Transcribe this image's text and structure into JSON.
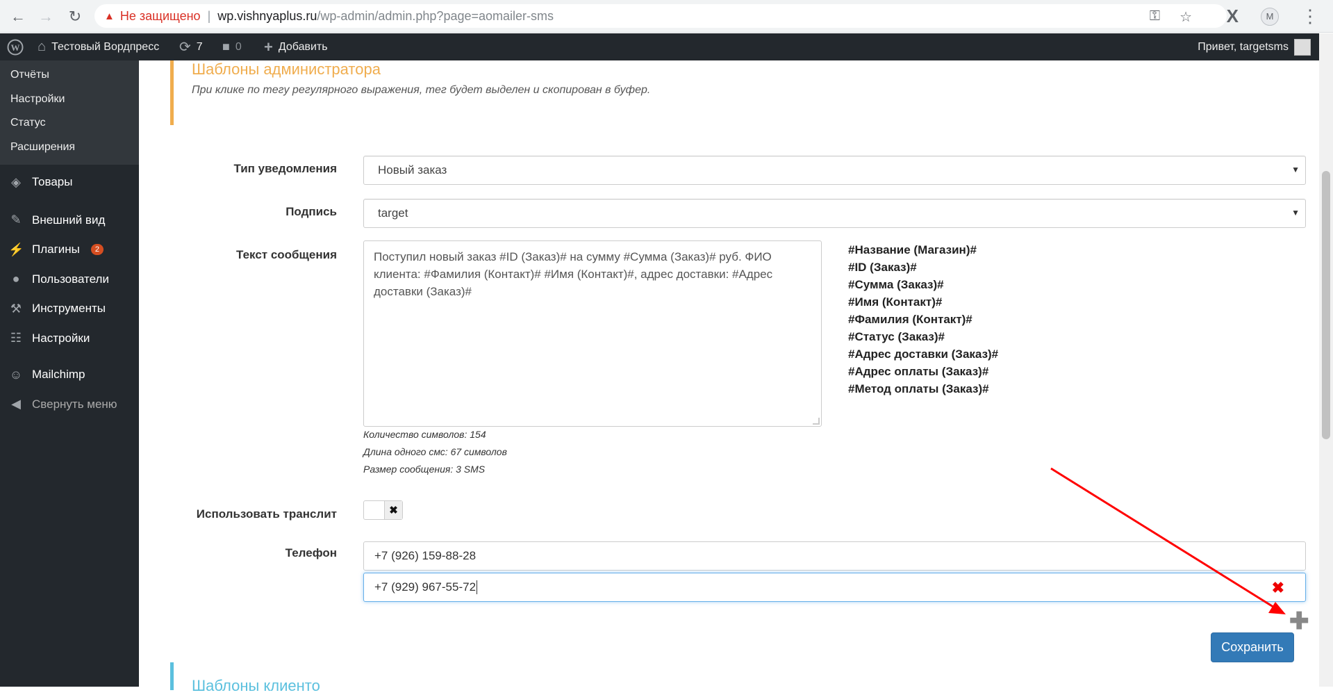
{
  "browser": {
    "insecure_label": "Не защищено",
    "url_host": "wp.vishnyaplus.ru",
    "url_path": "/wp-admin/admin.php?page=aomailer-sms",
    "profile_initial": "M"
  },
  "adminbar": {
    "site_name": "Тестовый Вордпресс",
    "updates_count": "7",
    "comments_count": "0",
    "add_label": "Добавить",
    "greeting": "Привет, targetsms"
  },
  "sidebar": {
    "submenu": [
      "Отчёты",
      "Настройки",
      "Статус",
      "Расширения"
    ],
    "menu": {
      "products": "Товары",
      "appearance": "Внешний вид",
      "plugins": "Плагины",
      "plugins_badge": "2",
      "users": "Пользователи",
      "tools": "Инструменты",
      "settings": "Настройки",
      "mailchimp": "Mailchimp",
      "collapse": "Свернуть меню"
    }
  },
  "admin_templates": {
    "title": "Шаблоны администратора",
    "description": "При клике по тегу регулярного выражения, тег будет выделен и скопирован в буфер."
  },
  "form": {
    "notification_type_label": "Тип уведомления",
    "notification_type_value": "Новый заказ",
    "signature_label": "Подпись",
    "signature_value": "target",
    "message_label": "Текст сообщения",
    "message_text": "Поступил новый заказ #ID (Заказ)# на сумму #Сумма (Заказ)# руб. ФИО клиента: #Фамилия (Контакт)# #Имя (Контакт)#, адрес доставки: #Адрес доставки (Заказ)#",
    "tags": [
      "#Название (Магазин)#",
      "#ID (Заказ)#",
      "#Сумма (Заказ)#",
      "#Имя (Контакт)#",
      "#Фамилия (Контакт)#",
      "#Статус (Заказ)#",
      "#Адрес доставки (Заказ)#",
      "#Адрес оплаты (Заказ)#",
      "#Метод оплаты (Заказ)#"
    ],
    "char_count": "Количество символов: 154",
    "sms_length": "Длина одного смс: 67 символов",
    "message_size": "Размер сообщения: 3 SMS",
    "translit_label": "Использовать транслит",
    "translit_toggle": "✖",
    "phone_label": "Телефон",
    "phones": [
      "+7 (926) 159-88-28",
      "+7 (929) 967-55-72"
    ],
    "remove_icon": "✖",
    "add_icon": "✚",
    "save_label": "Сохранить"
  },
  "client_templates": {
    "title": "Шаблоны клиенто"
  },
  "colors": {
    "accent_admin": "#f0ad4e",
    "accent_client": "#5bc0de",
    "primary_button": "#337ab7",
    "annotation_arrow": "#ff0000"
  }
}
